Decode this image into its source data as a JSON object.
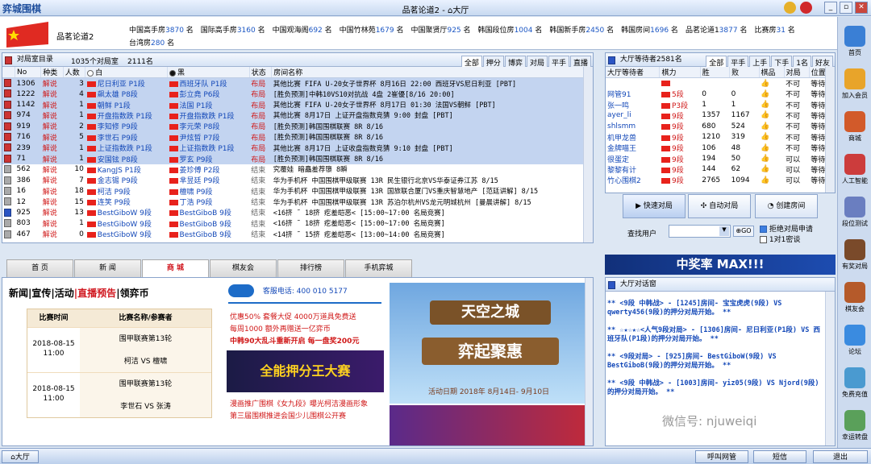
{
  "app": {
    "logo": "弈城围棋",
    "window_title": "品茗论道2 - ",
    "hall": "大厅"
  },
  "current_room": "品茗论道2",
  "rooms": [
    {
      "name": "中国高手房",
      "count": "3870",
      "unit": "名"
    },
    {
      "name": "国际高手房",
      "count": "3160",
      "unit": "名"
    },
    {
      "name": "中国观海阁",
      "count": "692",
      "unit": "名"
    },
    {
      "name": "中国竹林苑",
      "count": "1679",
      "unit": "名"
    },
    {
      "name": "中国聚贤厅",
      "count": "925",
      "unit": "名"
    },
    {
      "name": "韩国段位房",
      "count": "1004",
      "unit": "名"
    },
    {
      "name": "韩国新手房",
      "count": "2450",
      "unit": "名"
    },
    {
      "name": "韩国房间",
      "count": "1696",
      "unit": "名"
    },
    {
      "name": "品茗论道1",
      "count": "3877",
      "unit": "名"
    },
    {
      "name": "比赛房",
      "count": "31",
      "unit": "名"
    },
    {
      "name": "台湾房",
      "count": "280",
      "unit": "名"
    }
  ],
  "games_panel": {
    "title": "对局室目录",
    "count": "1035个对局室",
    "people": "2111名",
    "tabs": [
      "全部",
      "押分",
      "博弈",
      "对局",
      "平手",
      "直播"
    ],
    "headers": [
      "No",
      "种类",
      "人数",
      "白",
      "黑",
      "状态",
      "房间名称"
    ],
    "rows": [
      {
        "no": "1306",
        "type": "解说",
        "n": "3",
        "white": "尼日利亚 P1段",
        "black": "西班牙队 P1段",
        "status": "布局",
        "room": "其他比赛 FIFA U-20女子世界杯 8月16日 22:00 西班牙VS尼日利亚 [PBT]",
        "sel": true
      },
      {
        "no": "1222",
        "type": "解说",
        "n": "4",
        "white": "飙太雄 P8段",
        "black": "彭立堯 P6段",
        "status": "布局",
        "room": "[胜负预测]中韩10VS10对抗战 4盘 2崔優[8/16 20:00]",
        "sel": true
      },
      {
        "no": "1142",
        "type": "解说",
        "n": "1",
        "white": "朝鲜 P1段",
        "black": "法国 P1段",
        "status": "布局",
        "room": "其他比赛 FIFA U-20女子世界杯 8月17日 01:30 法国VS朝鲜 [PBT]",
        "sel": true
      },
      {
        "no": "974",
        "type": "解说",
        "n": "1",
        "white": "开盘指数跌 P1段",
        "black": "开盘指数跌 P1段",
        "status": "布局",
        "room": "其他比赛 8月17日 上证开盘指数竞猜 9:00 封盘 [PBT]",
        "sel": true
      },
      {
        "no": "919",
        "type": "解说",
        "n": "2",
        "white": "李知修 P9段",
        "black": "李元荣 P8段",
        "status": "布局",
        "room": "[胜负预测]韩国围棋联赛 8R 8/16",
        "sel": true
      },
      {
        "no": "716",
        "type": "解说",
        "n": "5",
        "white": "李世石 P9段",
        "black": "尹炫晳 P7段",
        "status": "布局",
        "room": "[胜负预测]韩国围棋联赛 8R 8/16",
        "sel": true
      },
      {
        "no": "239",
        "type": "解说",
        "n": "1",
        "white": "上证指数跌 P1段",
        "black": "上证指数跌 P1段",
        "status": "布局",
        "room": "其他比赛 8月17日 上证收盘指数竞猜 9:10 封盘 [PBT]",
        "sel": true
      },
      {
        "no": "71",
        "type": "解说",
        "n": "1",
        "white": "安国铉 P8段",
        "black": "罗玄 P9段",
        "status": "布局",
        "room": "[胜负预测]韩国围棋联赛 8R 8/16",
        "sel": true
      },
      {
        "no": "562",
        "type": "解说",
        "n": "10",
        "white": "KangJS P1段",
        "black": "姜珍傅 P2段",
        "status": "结束",
        "room": "究覆娃 暗矗羞荐隳 8瞬",
        "sel": false
      },
      {
        "no": "386",
        "type": "解说",
        "n": "7",
        "white": "金志锡 P9段",
        "black": "芈昱廷 P9段",
        "status": "结束",
        "room": "华为手机杯 中国围棋甲级联赛 13R  民生银行北京VS华泰证券江苏 8/15",
        "sel": false
      },
      {
        "no": "16",
        "type": "解说",
        "n": "18",
        "white": "柯洁 P9段",
        "black": "檀啸 P9段",
        "status": "结束",
        "room": "华为手机杯 中国围棋甲级联赛 13R  国旅联合厦门VS重庆智慧地产 [范廷讲解] 8/15",
        "sel": false
      },
      {
        "no": "12",
        "type": "解说",
        "n": "15",
        "white": "连笑 P9段",
        "black": "丁浩 P9段",
        "status": "结束",
        "room": "华为手机杯 中国围棋甲级联赛 13R  苏泊尔杭州VS龙元明城杭州 [曼晨讲解] 8/15",
        "sel": false
      },
      {
        "no": "925",
        "type": "解说",
        "n": "13",
        "white": "BestGiboW 9段",
        "black": "BestGiboB 9段",
        "status": "结束",
        "room": "<16挤 ˜ 18挤 疙羞皑恶< [15:00~17:00 名局竞赛]",
        "sel": false
      },
      {
        "no": "803",
        "type": "解说",
        "n": "1",
        "white": "BestGiboW 9段",
        "black": "BestGiboB 9段",
        "status": "结束",
        "room": "<16挤 ˜ 18挤 疙羞皑恶< [15:00~17:00 名局竞赛]",
        "sel": false
      },
      {
        "no": "467",
        "type": "解说",
        "n": "0",
        "white": "BestGiboW 9段",
        "black": "BestGiboB 9段",
        "status": "结束",
        "room": "<14挤 ˜ 15挤 疙羞皑恶< [13:00~14:00 名局竞赛]",
        "sel": false
      }
    ]
  },
  "bottom_tabs": [
    "首 页",
    "新 闻",
    "商 城",
    "棋友会",
    "排行榜",
    "手机弈城"
  ],
  "news": {
    "tabs": [
      "新闻",
      "|宣传",
      "|活动",
      "|直播预告",
      "|领弈币"
    ],
    "schedule_headers": [
      "比赛时间",
      "比赛名称/参赛者"
    ],
    "schedule": [
      {
        "date": "2018-08-15",
        "time": "11:00",
        "event": "围甲联赛第13轮",
        "players": "柯洁 VS 檀啸"
      },
      {
        "date": "2018-08-15",
        "time": "11:00",
        "event": "围甲联赛第13轮",
        "players": "李世石 VS 张涛"
      }
    ],
    "hotline": "客服电话: 400 010 5177",
    "promos": [
      "优惠50% 套餐大促 4000万道具免费送",
      "每周1000 额外再赠送一亿弈币",
      "中韩90大乱斗重新开启 每一盘奖200元"
    ],
    "banner1": "全能押分王大赛",
    "promos2": [
      "漫画推广围棋《女九段》曝光柯洁漫画形象",
      "第三届围棋推进会国少儿围棋公开赛"
    ],
    "banner2_title": "天空之城",
    "banner2_sub": "弈起聚惠",
    "banner2_date": "活动日期  2018年 8月14日- 9月10日"
  },
  "waiting": {
    "title": "大厅等待者2581名",
    "tabs": [
      "全部",
      "平手",
      "上手",
      "下手",
      "1名",
      "好友"
    ],
    "headers": [
      "大厅等待者",
      "棋力",
      "胜",
      "败",
      "棋品",
      "对局",
      "位置"
    ],
    "rows": [
      {
        "name": "",
        "rank": "",
        "w": "",
        "l": "",
        "manner": "",
        "play": "不可",
        "loc": "等待"
      },
      {
        "name": "网管91",
        "rank": "5段",
        "w": "0",
        "l": "0",
        "manner": "",
        "play": "不可",
        "loc": "等待"
      },
      {
        "name": "张一鸣",
        "rank": "P3段",
        "w": "1",
        "l": "1",
        "manner": "",
        "play": "不可",
        "loc": "等待"
      },
      {
        "name": "ayer_li",
        "rank": "9段",
        "w": "1357",
        "l": "1167",
        "manner": "",
        "play": "不可",
        "loc": "等待"
      },
      {
        "name": "shlsmm",
        "rank": "9段",
        "w": "680",
        "l": "524",
        "manner": "",
        "play": "不可",
        "loc": "等待"
      },
      {
        "name": "机甲龙兽",
        "rank": "9段",
        "w": "1210",
        "l": "319",
        "manner": "",
        "play": "不可",
        "loc": "等待"
      },
      {
        "name": "金牌喵王",
        "rank": "9段",
        "w": "106",
        "l": "48",
        "manner": "",
        "play": "不可",
        "loc": "等待"
      },
      {
        "name": "很蛋定",
        "rank": "9段",
        "w": "194",
        "l": "50",
        "manner": "",
        "play": "可以",
        "loc": "等待"
      },
      {
        "name": "黎黎有计",
        "rank": "9段",
        "w": "144",
        "l": "62",
        "manner": "",
        "play": "可以",
        "loc": "等待"
      },
      {
        "name": "竹心围棋2",
        "rank": "9段",
        "w": "2765",
        "l": "1094",
        "manner": "",
        "play": "可以",
        "loc": "等待"
      }
    ],
    "quick_btn": "快速对局",
    "auto_btn": "自动对局",
    "create_btn": "创建房间",
    "search_label": "查找用户",
    "go": "GO",
    "opt1": "拒绝对局申请",
    "opt2": "1对1密谈",
    "ad": "中奖率 MAX!!!"
  },
  "chat": {
    "title": "大厅对话窗",
    "lines": [
      "** <9段 中韩战> - [1245]房间- 宝宝虎虎(9段) VS qwerty456(9段)的押分对局开始。 **",
      "** ☆★☆★☆<人气9段对局> - [1306]房间- 尼日利亚(P1段) VS 西班牙队(P1段)的押分对局开始。 **",
      "** <9段对局> - [925]房间- BestGiboW(9段) VS BestGiboB(9段)的押分对局开始。 **",
      "** <9段 中韩战> - [1003]房间- yiz05(9段) VS Njord(9段)的押分对局开始。 **"
    ],
    "watermark": "微信号: njuweiqi"
  },
  "sidebar": [
    "首页",
    "加入会员",
    "商城",
    "人工智能",
    "段位测试",
    "有奖对局",
    "棋友会",
    "论坛",
    "免费充值",
    "幸运转盘"
  ],
  "status": {
    "hall": "大厅",
    "call": "呼叫网管",
    "sms": "短信",
    "exit": "退出"
  },
  "colors": {
    "accent": "#1d4d9c",
    "red": "#d01818",
    "blue": "#1348b8"
  }
}
